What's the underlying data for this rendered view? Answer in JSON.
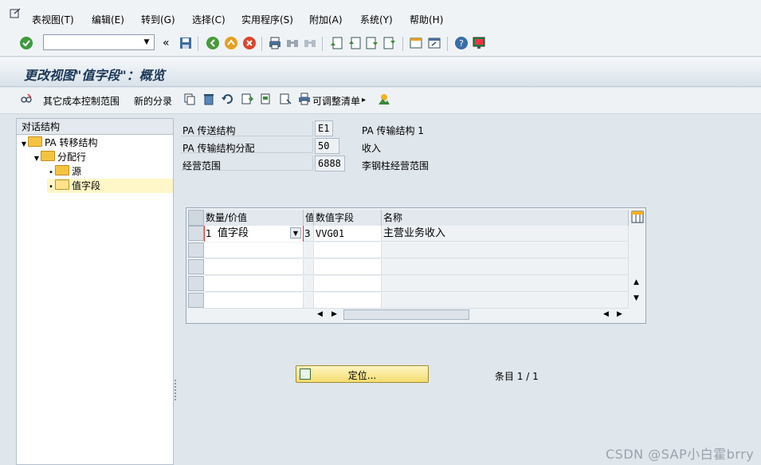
{
  "menu": [
    "表视图(T)",
    "编辑(E)",
    "转到(G)",
    "选择(C)",
    "实用程序(S)",
    "附加(A)",
    "系统(Y)",
    "帮助(H)"
  ],
  "toolbar": {
    "command_value": "",
    "collapse_glyph": "«"
  },
  "page_title": "更改视图\"值字段\"：概览",
  "app_toolbar": {
    "btn_other_cost": "其它成本控制范围",
    "btn_new_entries": "新的分录",
    "btn_adjustable_list": "可调整清单"
  },
  "tree": {
    "header": "对话结构",
    "items": [
      {
        "label": "PA 转移结构"
      },
      {
        "label": "分配行"
      },
      {
        "label": "源"
      },
      {
        "label": "值字段"
      }
    ]
  },
  "fields": {
    "transfer_structure": {
      "label": "PA 传送结构",
      "value": "E1",
      "text": "PA 传输结构 1"
    },
    "assignment": {
      "label": "PA 传输结构分配",
      "value": "50",
      "text": "收入"
    },
    "op_concern": {
      "label": "经营范围",
      "value": "6888",
      "text": "李钢柱经营范围"
    }
  },
  "table": {
    "columns": [
      "数量/价值",
      "值",
      "数值字段",
      "名称"
    ],
    "rows": [
      {
        "type_code": "1",
        "type_text": "值字段",
        "col2": "3",
        "value_field": "VVG01",
        "name": "主营业务收入"
      }
    ]
  },
  "locate_button": "定位...",
  "entry_count": "条目 1 / 1",
  "watermark": "CSDN @SAP小白霍brry"
}
